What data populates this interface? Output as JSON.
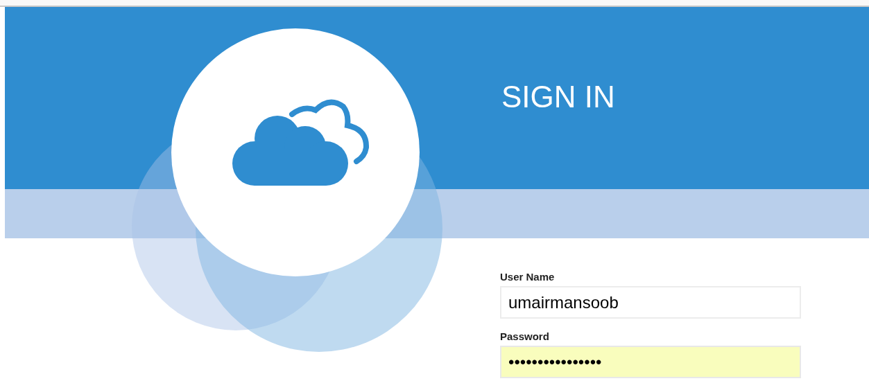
{
  "header": {
    "title": "SIGN IN"
  },
  "form": {
    "fields": [
      {
        "label": "User Name",
        "value": "umairmansoob",
        "autofilled": false
      },
      {
        "label": "Password",
        "value": "••••••••••••••••",
        "autofilled": true
      }
    ]
  }
}
